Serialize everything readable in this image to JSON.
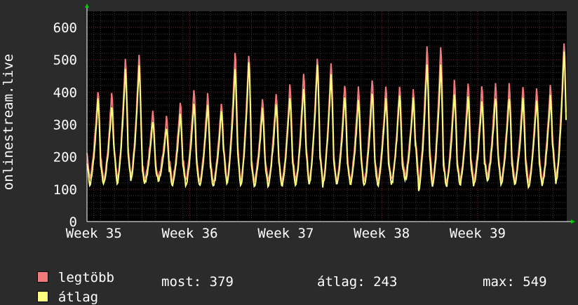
{
  "chart_data": {
    "type": "line",
    "ylabel": "onlinestream.live",
    "ylim": [
      0,
      650
    ],
    "yticks": [
      0,
      100,
      200,
      300,
      400,
      500,
      600
    ],
    "xticks": [
      "Week 35",
      "Week 36",
      "Week 37",
      "Week 38",
      "Week 39"
    ],
    "grid": true,
    "legend_placement": "bottom",
    "days": 35,
    "series": [
      {
        "name": "legtöbb",
        "color": "#f07a7a",
        "daily_peaks": [
          420,
          410,
          520,
          535,
          350,
          330,
          380,
          420,
          410,
          380,
          545,
          540,
          395,
          410,
          440,
          470,
          530,
          510,
          440,
          430,
          460,
          430,
          430,
          420,
          560,
          565,
          450,
          440,
          430,
          440,
          440,
          430,
          425,
          440,
          580
        ],
        "daily_lows": [
          135,
          125,
          130,
          140,
          130,
          140,
          125,
          125,
          120,
          120,
          125,
          120,
          125,
          125,
          120,
          125,
          125,
          125,
          125,
          125,
          120,
          125,
          125,
          140,
          120,
          120,
          120,
          125,
          125,
          140,
          125,
          125,
          120,
          125,
          130
        ]
      },
      {
        "name": "átlag",
        "color": "#fcfc7e",
        "daily_peaks": [
          390,
          370,
          490,
          500,
          320,
          300,
          340,
          380,
          370,
          350,
          490,
          510,
          360,
          380,
          400,
          430,
          500,
          470,
          400,
          390,
          410,
          395,
          400,
          390,
          510,
          500,
          410,
          400,
          390,
          400,
          400,
          390,
          390,
          400,
          545
        ],
        "daily_lows": [
          115,
          115,
          118,
          125,
          118,
          125,
          112,
          112,
          110,
          108,
          112,
          108,
          112,
          112,
          108,
          112,
          112,
          112,
          112,
          112,
          108,
          112,
          112,
          125,
          100,
          105,
          108,
          112,
          112,
          125,
          112,
          112,
          108,
          112,
          118
        ]
      }
    ]
  },
  "legend": {
    "items": [
      {
        "label": "legtöbb",
        "color": "#f07a7a"
      },
      {
        "label": "átlag",
        "color": "#fcfc7e"
      }
    ]
  },
  "stats": {
    "most": "most: 379",
    "avg": "átlag: 243",
    "max": "max: 549"
  }
}
